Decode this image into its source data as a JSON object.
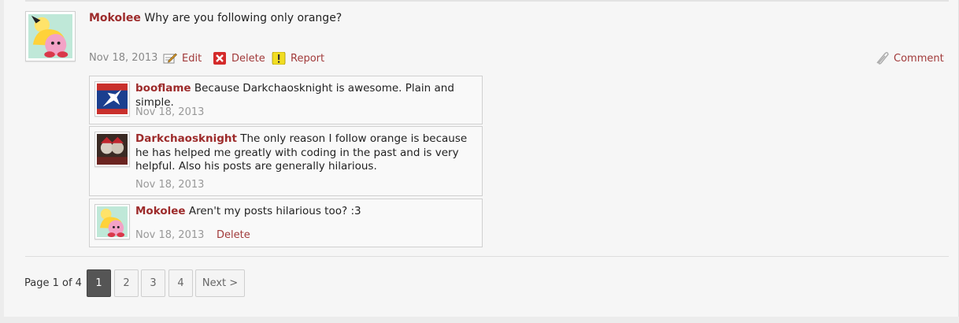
{
  "post": {
    "author": "Mokolee",
    "message": "Why are you following only orange?",
    "date": "Nov 18, 2013",
    "actions": {
      "edit": "Edit",
      "delete": "Delete",
      "report": "Report",
      "comment": "Comment"
    }
  },
  "comments": [
    {
      "author": "booflame",
      "message": "Because Darkchaosknight is awesome. Plain and simple.",
      "date": "Nov 18, 2013"
    },
    {
      "author": "Darkchaosknight",
      "message": "The only reason I follow orange is because he has helped me greatly with coding in the past and is very helpful. Also his posts are generally hilarious.",
      "date": "Nov 18, 2013"
    },
    {
      "author": "Mokolee",
      "message": "Aren't my posts hilarious too? :3",
      "date": "Nov 18, 2013",
      "delete": "Delete"
    }
  ],
  "pagination": {
    "label": "Page 1 of 4",
    "pages": [
      "1",
      "2",
      "3",
      "4"
    ],
    "current": "1",
    "next": "Next >"
  },
  "colors": {
    "accent": "#9d2b2b",
    "active_page": "#555555"
  },
  "icons": {
    "edit": "pencil-icon",
    "delete": "delete-x-icon",
    "report": "warning-icon",
    "comment": "paperclip-icon"
  }
}
